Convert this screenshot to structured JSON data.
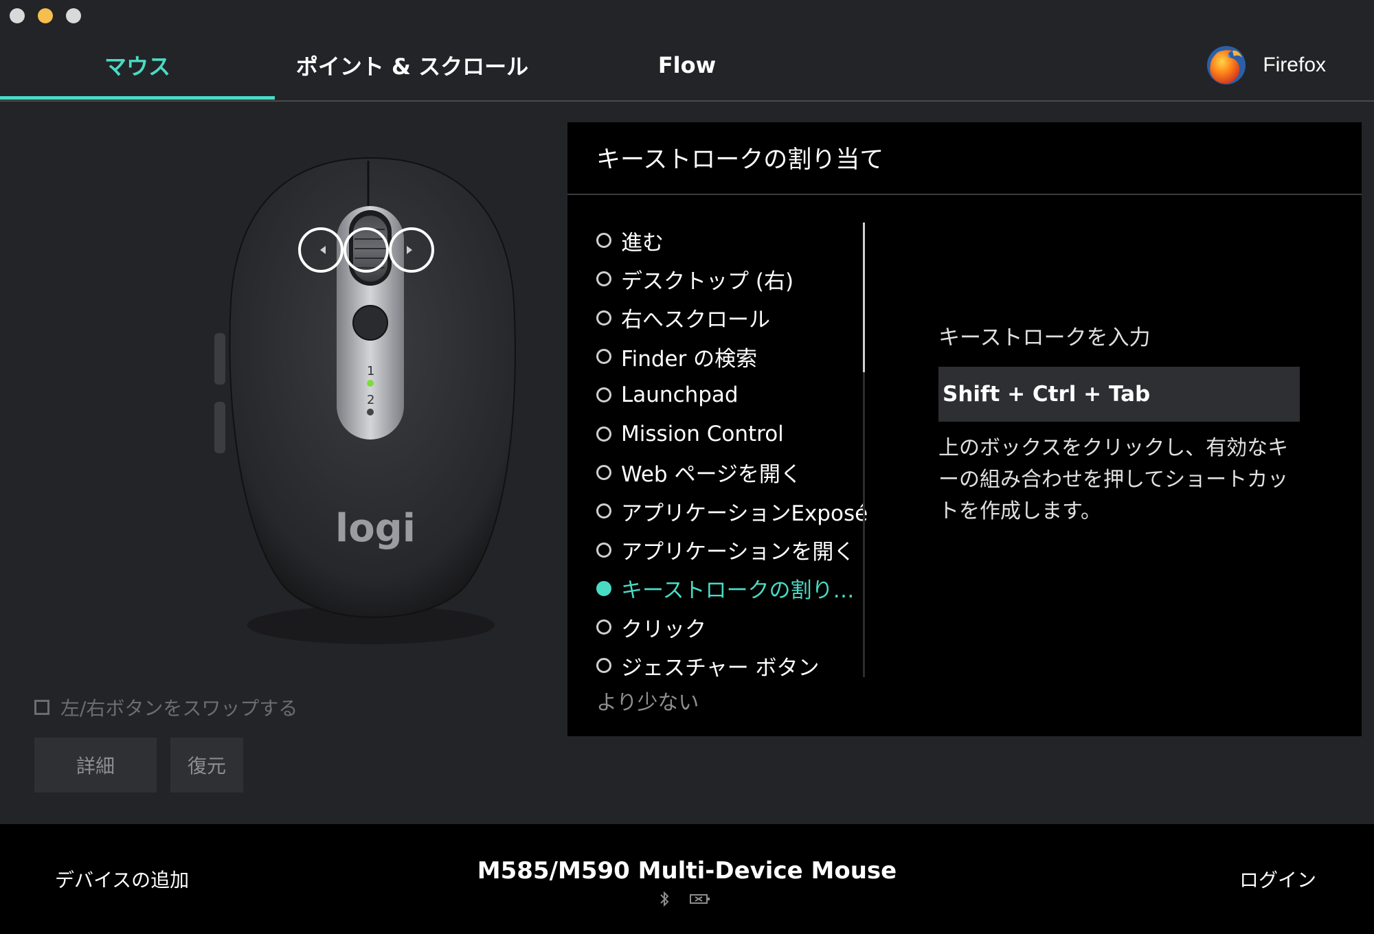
{
  "tabs": [
    {
      "label": "マウス",
      "active": true
    },
    {
      "label": "ポイント & スクロール",
      "active": false
    },
    {
      "label": "Flow",
      "active": false
    }
  ],
  "app": {
    "name": "Firefox",
    "icon": "firefox-icon"
  },
  "mouse": {
    "brand": "logi",
    "channel_1": "1",
    "channel_2": "2",
    "hotspots": [
      "tilt-left",
      "wheel",
      "tilt-right"
    ]
  },
  "swap": {
    "label": "左/右ボタンをスワップする",
    "checked": false
  },
  "buttons": {
    "detail": "詳細",
    "reset": "復元"
  },
  "panel": {
    "title": "キーストロークの割り当て",
    "actions": [
      "進む",
      "デスクトップ (右)",
      "右へスクロール",
      "Finder の検索",
      "Launchpad",
      "Mission Control",
      "Web ページを開く",
      "アプリケーションExposé",
      "アプリケーションを開く",
      "キーストロークの割り…",
      "クリック",
      "ジェスチャー ボタン"
    ],
    "selected_index": 9,
    "less_label": "より少ない",
    "keystroke_label": "キーストロークを入力",
    "keystroke_value": "Shift + Ctrl + Tab",
    "help_text": "上のボックスをクリックし、有効なキーの組み合わせを押してショートカットを作成します。"
  },
  "footer": {
    "add_device": "デバイスの追加",
    "device_name": "M585/M590 Multi-Device Mouse",
    "login": "ログイン",
    "icons": [
      "bluetooth-icon",
      "battery-icon"
    ]
  },
  "colors": {
    "accent": "#49dbc5",
    "background": "#232427",
    "panel": "#000000",
    "footer": "#000000"
  }
}
